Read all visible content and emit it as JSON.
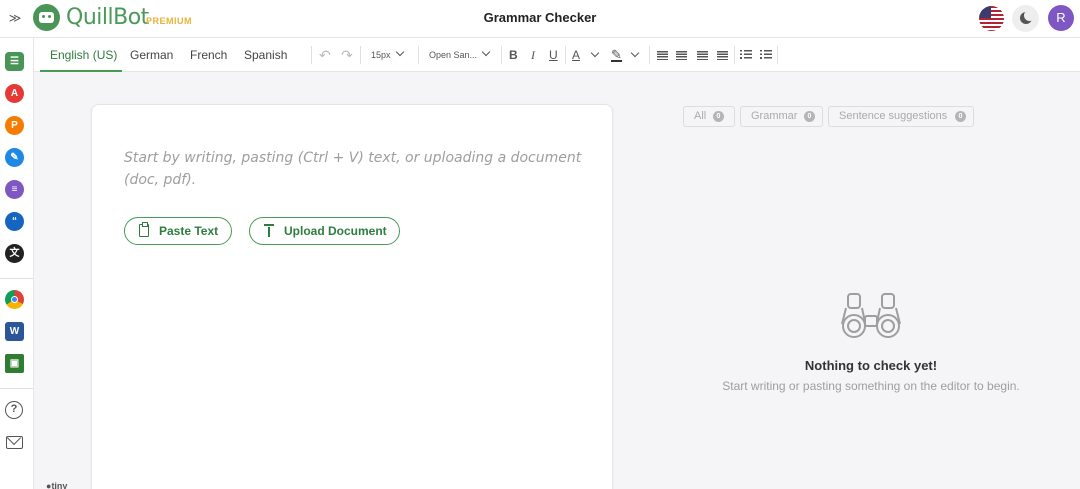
{
  "header": {
    "logo_text": "QuillBot",
    "premium_label": "PREMIUM",
    "title": "Grammar Checker",
    "avatar_initial": "R",
    "icons": [
      "menu-toggle-icon",
      "logo-icon",
      "us-flag-icon",
      "moon-icon"
    ]
  },
  "sidebar": {
    "items": [
      {
        "name": "paraphraser",
        "color": "#499557"
      },
      {
        "name": "grammar-checker",
        "color": "#e53935"
      },
      {
        "name": "plagiarism-checker",
        "color": "#f57c00"
      },
      {
        "name": "co-writer",
        "color": "#1e88e5"
      },
      {
        "name": "summarizer",
        "color": "#7e57c2"
      },
      {
        "name": "citation-generator",
        "color": "#1565c0"
      },
      {
        "name": "translator",
        "color": "#222222"
      },
      {
        "name": "chrome-extension",
        "color": "#4caf50"
      },
      {
        "name": "word-addin",
        "color": "#2b579a"
      },
      {
        "name": "desktop-app",
        "color": "#2e7d32"
      }
    ],
    "help_symbol": "?"
  },
  "toolbar": {
    "languages": [
      "English (US)",
      "German",
      "French",
      "Spanish"
    ],
    "active_language": "English (US)",
    "font_size": "15px",
    "font_family": "Open San...",
    "bold": "B",
    "italic": "I",
    "underline": "U",
    "text_color": "A"
  },
  "editor": {
    "placeholder": "Start by writing, pasting (Ctrl + V) text, or uploading a document (doc, pdf).",
    "paste_label": "Paste Text",
    "upload_label": "Upload Document",
    "tiny_label": "tiny"
  },
  "filters": [
    {
      "label": "All",
      "count": "0"
    },
    {
      "label": "Grammar",
      "count": "0"
    },
    {
      "label": "Sentence suggestions",
      "count": "0"
    }
  ],
  "empty_state": {
    "title": "Nothing to check yet!",
    "subtitle": "Start writing or pasting something on the editor to begin."
  },
  "colors": {
    "brand_green": "#499557",
    "accent_text_green": "#2e7d3e",
    "premium_gold": "#e8b23a",
    "avatar_purple": "#7e57c2"
  }
}
